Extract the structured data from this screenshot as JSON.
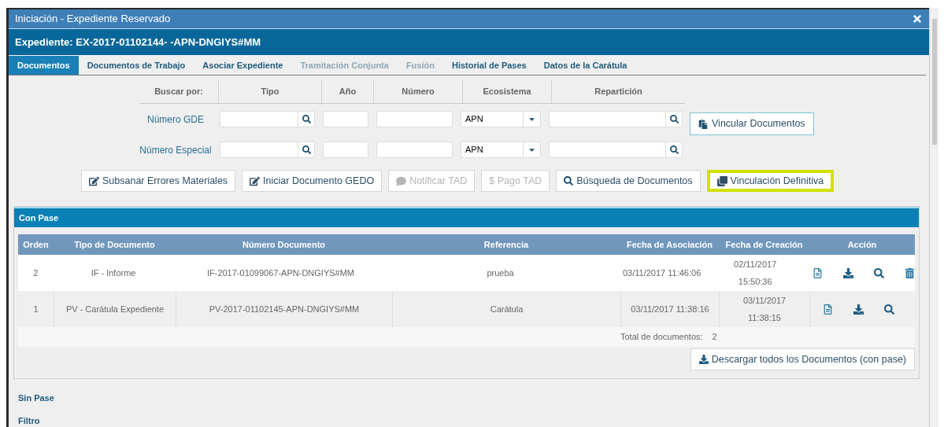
{
  "window": {
    "title": "Iniciación - Expediente Reservado"
  },
  "expediente": "Expediente: EX-2017-01102144- -APN-DNGIYS#MM",
  "tabs": [
    {
      "label": "Documentos",
      "selected": true,
      "disabled": false
    },
    {
      "label": "Documentos de Trabajo",
      "selected": false,
      "disabled": false
    },
    {
      "label": "Asociar Expediente",
      "selected": false,
      "disabled": false
    },
    {
      "label": "Tramitación Conjunta",
      "selected": false,
      "disabled": true
    },
    {
      "label": "Fusión",
      "selected": false,
      "disabled": true
    },
    {
      "label": "Historial de Pases",
      "selected": false,
      "disabled": false
    },
    {
      "label": "Datos de la Carátula",
      "selected": false,
      "disabled": false
    }
  ],
  "search": {
    "label": "Buscar por:",
    "columns": [
      "Tipo",
      "Año",
      "Número",
      "Ecosistema",
      "Repartición"
    ],
    "rows": [
      {
        "label": "Número GDE",
        "ecosistema": "APN"
      },
      {
        "label": "Número Especial",
        "ecosistema": "APN"
      }
    ],
    "link_button": "Vincular Documentos"
  },
  "actions": [
    {
      "label": "Subsanar Errores Materiales",
      "kind": "edit",
      "disabled": false,
      "highlighted": false
    },
    {
      "label": "Iniciar Documento GEDO",
      "kind": "edit",
      "disabled": false,
      "highlighted": false
    },
    {
      "label": "Notificar TAD",
      "kind": "comment",
      "disabled": true,
      "highlighted": false
    },
    {
      "label": "$ Pago TAD",
      "kind": "plain",
      "disabled": true,
      "highlighted": false
    },
    {
      "label": "Búsqueda de Documentos",
      "kind": "search",
      "disabled": false,
      "highlighted": false
    },
    {
      "label": "Vinculación Definitiva",
      "kind": "copy",
      "disabled": false,
      "highlighted": true
    }
  ],
  "con_pase": {
    "title": "Con Pase",
    "columns": [
      "Orden",
      "Tipo de Documento",
      "Número Documento",
      "Referencia",
      "Fecha de Asociación",
      "Fecha de Creación",
      "Acción"
    ],
    "rows": [
      {
        "orden": "2",
        "tipo": "IF - Informe",
        "numero": "IF-2017-01099067-APN-DNGIYS#MM",
        "referencia": "prueba",
        "fecha_asociacion": "03/11/2017 11:46:06",
        "fecha_creacion": [
          "02/11/2017",
          "15:50:36"
        ],
        "actions": [
          {
            "kind": "view"
          },
          {
            "kind": "download"
          },
          {
            "kind": "search"
          },
          {
            "kind": "delete"
          }
        ]
      },
      {
        "orden": "1",
        "tipo": "PV - Carátula Expediente",
        "numero": "PV-2017-01102145-APN-DNGIYS#MM",
        "referencia": "Carátula",
        "fecha_asociacion": "03/11/2017 11:38:16",
        "fecha_creacion": [
          "03/11/2017",
          "11:38:15"
        ],
        "actions": [
          {
            "kind": "view"
          },
          {
            "kind": "download"
          },
          {
            "kind": "search"
          }
        ]
      }
    ],
    "total_label": "Total de documentos:",
    "total": "2",
    "download_button": "Descargar todos los Documentos (con pase)"
  },
  "sin_pase": "Sin Pase",
  "filtro": "Filtro"
}
